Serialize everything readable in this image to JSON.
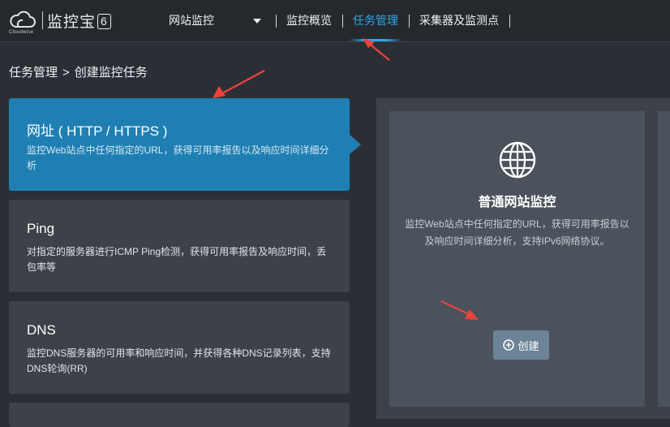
{
  "logo": {
    "brand_small": "Cloudwise",
    "title": "监控宝",
    "badge": "6"
  },
  "nav": {
    "items": [
      {
        "label": "网站监控",
        "active": false
      },
      {
        "label": "监控概览",
        "active": false
      },
      {
        "label": "任务管理",
        "active": true
      },
      {
        "label": "采集器及监测点",
        "active": false
      }
    ]
  },
  "breadcrumb": {
    "parent": "任务管理",
    "separator": ">",
    "current": "创建监控任务"
  },
  "task_types": [
    {
      "title": "网址 ( HTTP / HTTPS )",
      "desc": "监控Web站点中任何指定的URL，获得可用率报告以及响应时间详细分析",
      "selected": true
    },
    {
      "title": "Ping",
      "desc": "对指定的服务器进行ICMP Ping检测，获得可用率报告及响应时间，丢包率等",
      "selected": false
    },
    {
      "title": "DNS",
      "desc": "监控DNS服务器的可用率和响应时间，并获得各种DNS记录列表，支持DNS轮询(RR)",
      "selected": false
    }
  ],
  "option": {
    "icon": "globe-icon",
    "title": "普通网站监控",
    "desc": "监控Web站点中任何指定的URL，获得可用率报告以及响应时间详细分析，支持IPv6网络协议。",
    "create_label": "创建"
  },
  "colors": {
    "accent": "#2fa4e7",
    "selected_card": "#1f7fb3",
    "annotation_arrow": "#e8433d"
  }
}
